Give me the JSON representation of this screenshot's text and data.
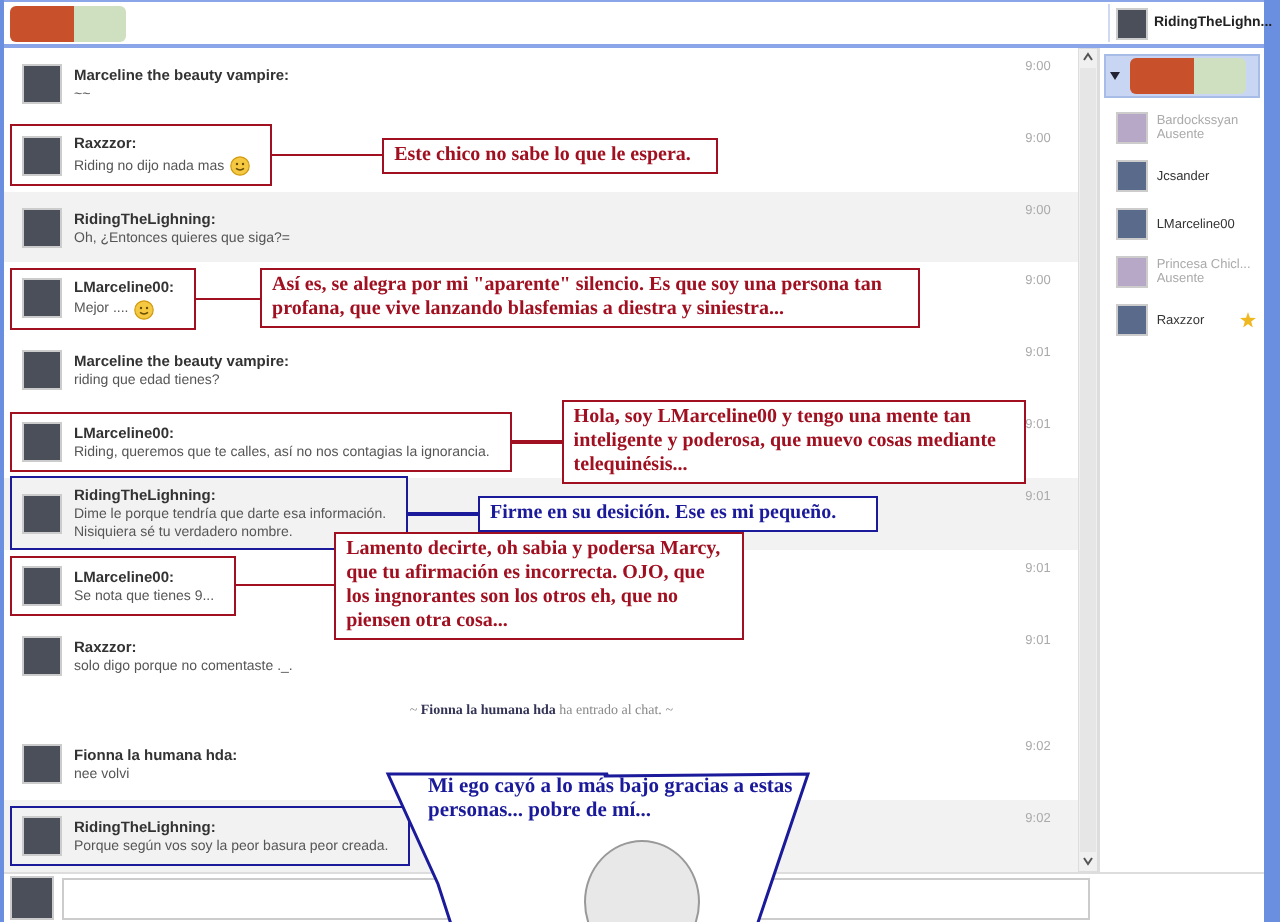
{
  "header": {
    "user_name": "RidingTheLighn..."
  },
  "messages": [
    {
      "kind": "message",
      "user": "Marceline the beauty vampire:",
      "text": "~~",
      "time": "9:00",
      "own": false,
      "emoticon": false
    },
    {
      "kind": "message",
      "user": "Raxzzor:",
      "text": "Riding no dijo nada mas",
      "time": "9:00",
      "own": false,
      "emoticon": true,
      "annotation": {
        "kind": "box",
        "text": "Este chico no sabe lo que le espera.",
        "color": "#a01020"
      }
    },
    {
      "kind": "message",
      "user": "RidingTheLighning:",
      "text": "Oh, ¿Entonces quieres que siga?=",
      "time": "9:00",
      "own": true,
      "emoticon": false
    },
    {
      "kind": "message",
      "user": "LMarceline00:",
      "text": "Mejor ....",
      "time": "9:00",
      "own": false,
      "emoticon": true,
      "annotation": {
        "kind": "box",
        "text": "Así es, se alegra por mi \"aparente\" silencio. Es que soy una persona tan profana, que vive lanzando blasfemias a diestra y siniestra...",
        "color": "#a01020"
      }
    },
    {
      "kind": "message",
      "user": "Marceline the beauty vampire:",
      "text": "riding que edad tienes?",
      "time": "9:01",
      "own": false,
      "emoticon": false
    },
    {
      "kind": "message",
      "user": "LMarceline00:",
      "text": "Riding, queremos que te calles, así no nos contagias la ignorancia.",
      "time": "9:01",
      "own": false,
      "emoticon": false,
      "annotation": {
        "kind": "box",
        "text": "Hola, soy LMarceline00 y tengo una mente tan inteligente y poderosa, que muevo cosas mediante telequinésis...",
        "color": "#a01020"
      }
    },
    {
      "kind": "message",
      "user": "RidingTheLighning:",
      "text": "Dime le porque tendría que darte esa información.",
      "text_2": "Nisiquiera sé tu verdadero nombre.",
      "time": "9:01",
      "own": true,
      "emoticon": false,
      "annotation": {
        "kind": "box",
        "text": "Firme en su desición. Ese es mi pequeño.",
        "color": "#1a1a9a"
      }
    },
    {
      "kind": "message",
      "user": "LMarceline00:",
      "text": "Se nota que tienes 9...",
      "time": "9:01",
      "own": false,
      "emoticon": false,
      "annotation": {
        "kind": "box",
        "text": "Lamento decirte, oh sabia y podersa Marcy, que tu afirmación es incorrecta. OJO, que los ingnorantes son los otros eh, que no piensen otra cosa...",
        "color": "#a01020"
      }
    },
    {
      "kind": "message",
      "user": "Raxzzor:",
      "text": "solo digo porque no comentaste ._.",
      "time": "9:01",
      "own": false,
      "emoticon": false
    },
    {
      "kind": "system",
      "lead": "~",
      "user": "Fionna la humana hda",
      "text": "ha entrado al chat.",
      "trail": "~"
    },
    {
      "kind": "message",
      "user": "Fionna la humana hda:",
      "text": "nee volvi",
      "time": "9:02",
      "own": false,
      "emoticon": false
    },
    {
      "kind": "message",
      "user": "RidingTheLighning:",
      "text": "Porque según vos soy la peor basura peor creada.",
      "time": "9:02",
      "own": true,
      "emoticon": false,
      "annotation": {
        "kind": "speech",
        "text": "Mi ego cayó a lo más bajo gracias a estas personas... pobre de mí...",
        "color": "#1a1a9a"
      }
    }
  ],
  "sidebar": {
    "users": [
      {
        "name": "Bardockssyan",
        "status": "Ausente",
        "away": true,
        "starred": false
      },
      {
        "name": "Jcsander",
        "away": false,
        "starred": false
      },
      {
        "name": "LMarceline00",
        "away": false,
        "starred": false
      },
      {
        "name": "Princesa Chicl...",
        "status": "Ausente",
        "away": true,
        "starred": false
      },
      {
        "name": "Raxzzor",
        "away": false,
        "starred": true
      }
    ]
  }
}
